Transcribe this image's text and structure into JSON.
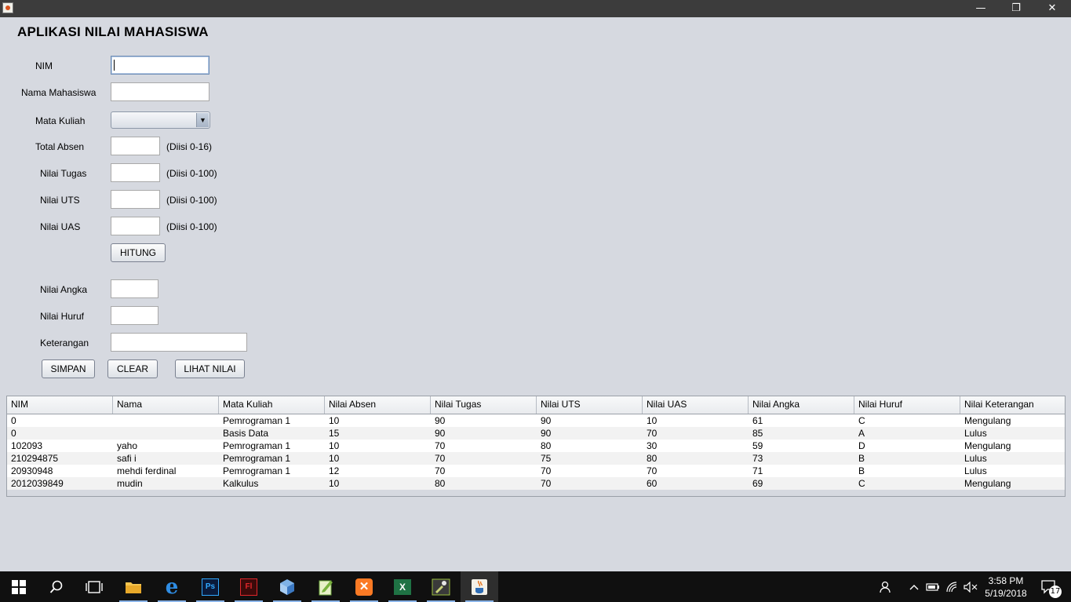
{
  "window": {
    "title": "",
    "minimize_glyph": "—",
    "restore_glyph": "❐",
    "close_glyph": "✕"
  },
  "form": {
    "heading": "APLIKASI NILAI MAHASISWA",
    "nim_label": "NIM",
    "nim_value": "",
    "nama_label": "Nama Mahasiswa",
    "nama_value": "",
    "matkul_label": "Mata Kuliah",
    "matkul_selected": "",
    "absen_label": "Total Absen",
    "absen_hint": "(Diisi 0-16)",
    "tugas_label": "Nilai Tugas",
    "tugas_hint": "(Diisi 0-100)",
    "uts_label": "Nilai UTS",
    "uts_hint": "(Diisi 0-100)",
    "uas_label": "Nilai UAS",
    "uas_hint": "(Diisi 0-100)",
    "hitung_button": "HITUNG",
    "angka_label": "Nilai Angka",
    "huruf_label": "Nilai Huruf",
    "keterangan_label": "Keterangan",
    "simpan_button": "SIMPAN",
    "clear_button": "CLEAR",
    "lihat_button": "LIHAT NILAI"
  },
  "table": {
    "columns": [
      "NIM",
      "Nama",
      "Mata Kuliah",
      "Nilai Absen",
      "Nilai Tugas",
      "Nilai UTS",
      "Nilai UAS",
      "Nilai Angka",
      "Nilai Huruf",
      "Nilai Keterangan"
    ],
    "rows": [
      [
        "0",
        "",
        "Pemrograman 1",
        "10",
        "90",
        "90",
        "10",
        "61",
        "C",
        "Mengulang"
      ],
      [
        "0",
        "",
        "Basis Data",
        "15",
        "90",
        "90",
        "70",
        "85",
        "A",
        "Lulus"
      ],
      [
        "102093",
        "yaho",
        "Pemrograman 1",
        "10",
        "70",
        "80",
        "30",
        "59",
        "D",
        "Mengulang"
      ],
      [
        "210294875",
        "safi i",
        "Pemrograman 1",
        "10",
        "70",
        "75",
        "80",
        "73",
        "B",
        "Lulus"
      ],
      [
        "20930948",
        "mehdi ferdinal",
        "Pemrograman 1",
        "12",
        "70",
        "70",
        "70",
        "71",
        "B",
        "Lulus"
      ],
      [
        "2012039849",
        "mudin",
        "Kalkulus",
        "10",
        "80",
        "70",
        "60",
        "69",
        "C",
        "Mengulang"
      ]
    ]
  },
  "taskbar": {
    "apps": [
      "windows-start",
      "search",
      "task-view",
      "file-explorer",
      "edge",
      "photoshop",
      "flash",
      "virtualbox",
      "notepad-plus-plus",
      "xampp",
      "excel",
      "tools",
      "java"
    ],
    "time": "3:58 PM",
    "date": "5/19/2018",
    "notification_count": "17"
  },
  "colors": {
    "window_bg": "#d6d9e0",
    "titlebar": "#3c3c3c",
    "taskbar": "#101010",
    "accent_focus": "#6b8bb4"
  }
}
